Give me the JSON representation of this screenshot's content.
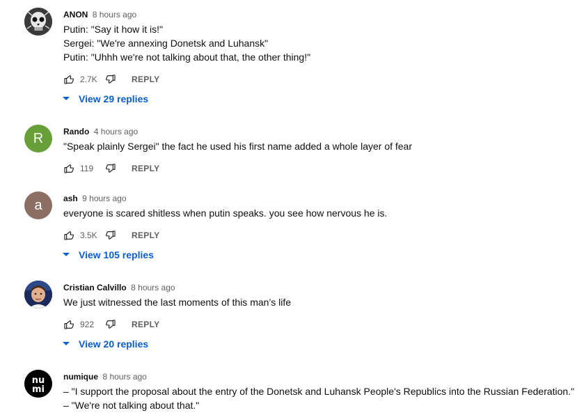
{
  "comments": [
    {
      "author": "ANON",
      "time": "8 hours ago",
      "lines": [
        "Putin: \"Say it how it is!\"",
        "Sergei: \"We're annexing Donetsk and Luhansk\"",
        "Putin: \"Uhhh we're not talking about that, the other thing!\""
      ],
      "likes": "2.7K",
      "reply_label": "REPLY",
      "view_replies": "View 29 replies",
      "avatar": {
        "type": "image",
        "icon": "skull-avatar",
        "bg": "#2b2b2b"
      }
    },
    {
      "author": "Rando",
      "time": "4 hours ago",
      "lines": [
        "\"Speak plainly Sergei\" the fact he used his first name added a whole layer of fear"
      ],
      "likes": "119",
      "reply_label": "REPLY",
      "avatar": {
        "type": "letter",
        "letter": "R",
        "bg": "#689f38"
      }
    },
    {
      "author": "ash",
      "time": "9 hours ago",
      "lines": [
        "everyone is scared shitless when putin speaks. you see how nervous he is."
      ],
      "likes": "3.5K",
      "reply_label": "REPLY",
      "view_replies": "View 105 replies",
      "avatar": {
        "type": "letter",
        "letter": "a",
        "bg": "#8d6e63"
      }
    },
    {
      "author": "Cristian Calvillo",
      "time": "8 hours ago",
      "lines": [
        "We just witnessed the last moments of this man’s life"
      ],
      "likes": "922",
      "reply_label": "REPLY",
      "view_replies": "View 20 replies",
      "avatar": {
        "type": "image",
        "icon": "photo-avatar",
        "bg": "#1b2b5c"
      }
    },
    {
      "author": "numique",
      "time": "8 hours ago",
      "lines": [
        "– \"I support the proposal about the entry of the Donetsk and Luhansk People's Republics into the Russian Federation.\"",
        "– \"We're not talking about that.\""
      ],
      "avatar": {
        "type": "logo",
        "logo_text": "nu mi",
        "bg": "#000000"
      }
    }
  ],
  "colors": {
    "link": "#065fd4",
    "secondary": "#606060",
    "text": "#0f0f0f"
  }
}
